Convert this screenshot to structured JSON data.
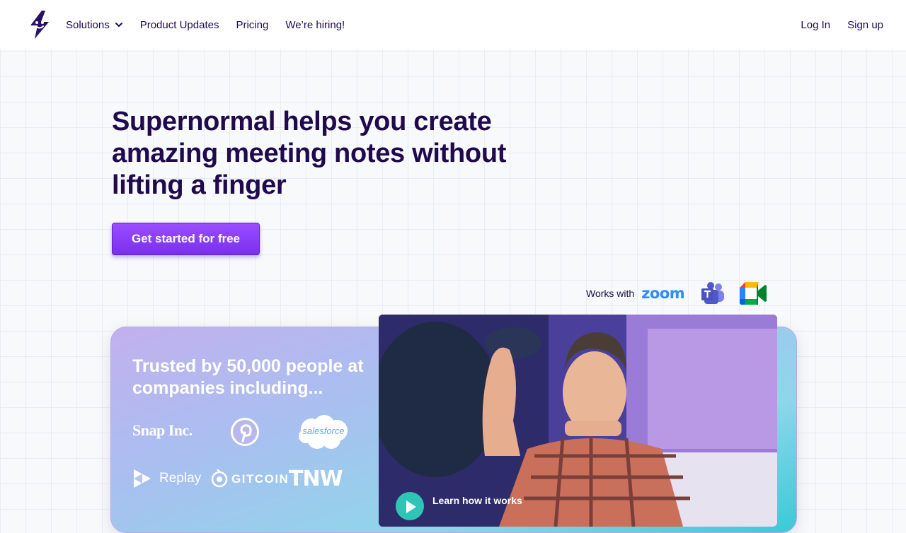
{
  "nav": {
    "logo": "supernormal-logo",
    "links": [
      "Solutions",
      "Product Updates",
      "Pricing",
      "We’re hiring!"
    ],
    "login": "Log In",
    "signup": "Sign up"
  },
  "hero": {
    "title": "Supernormal helps you create amazing meeting notes without lifting a finger",
    "cta": "Get started for free"
  },
  "works_with": {
    "label": "Works with",
    "zoom": "zoom",
    "teams_icon": "microsoft-teams-icon",
    "meet_icon": "google-meet-icon"
  },
  "trusted": {
    "title": "Trusted by 50,000 people at companies including...",
    "logos": {
      "snap": "Snap Inc.",
      "salesforce": "salesforce",
      "replay": "Replay",
      "gitcoin": "GITCOIN",
      "tnw": "TNW"
    }
  },
  "video": {
    "caption": "Learn how it works",
    "play_icon": "play-icon"
  },
  "colors": {
    "brand_dark": "#20094d",
    "cta_purple": "#7a2ff0",
    "teal": "#2ec4b6"
  }
}
